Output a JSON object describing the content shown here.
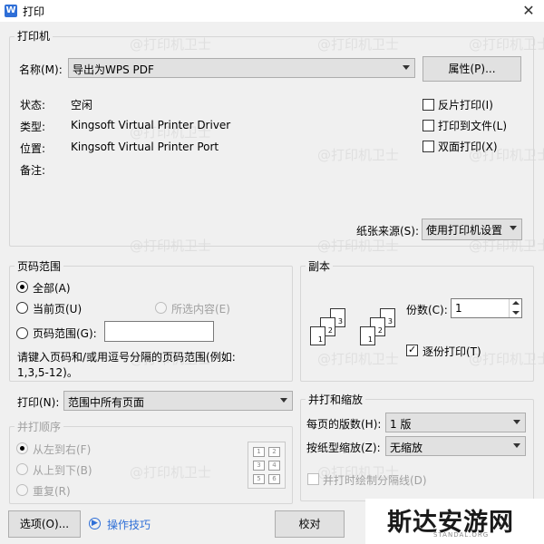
{
  "window": {
    "title": "打印",
    "app_icon": "W"
  },
  "printer": {
    "group_label": "打印机",
    "name_label": "名称(M):",
    "name_value": "导出为WPS PDF",
    "properties_button": "属性(P)...",
    "status_label": "状态:",
    "status_value": "空闲",
    "type_label": "类型:",
    "type_value": "Kingsoft Virtual Printer Driver",
    "location_label": "位置:",
    "location_value": "Kingsoft Virtual Printer Port",
    "comment_label": "备注:",
    "reverse_print": "反片打印(I)",
    "print_to_file": "打印到文件(L)",
    "duplex_print": "双面打印(X)",
    "paper_source_label": "纸张来源(S):",
    "paper_source_value": "使用打印机设置"
  },
  "page_range": {
    "group_label": "页码范围",
    "all": "全部(A)",
    "current_page": "当前页(U)",
    "selection": "所选内容(E)",
    "pages": "页码范围(G):",
    "pages_value": "",
    "hint_line1": "请键入页码和/或用逗号分隔的页码范围(例如:",
    "hint_line2": "1,3,5-12)。"
  },
  "copies": {
    "group_label": "副本",
    "count_label": "份数(C):",
    "count_value": "1",
    "collate": "逐份打印(T)",
    "sheet_numbers": [
      "1",
      "2",
      "3"
    ]
  },
  "print_what": {
    "label": "打印(N):",
    "value": "范围中所有页面"
  },
  "collate_order": {
    "group_label": "并打顺序",
    "left_to_right": "从左到右(F)",
    "top_to_bottom": "从上到下(B)",
    "repeat": "重复(R)",
    "grid_numbers": [
      "1",
      "2",
      "3",
      "4",
      "5",
      "6"
    ]
  },
  "zoom": {
    "group_label": "并打和缩放",
    "pages_per_sheet_label": "每页的版数(H):",
    "pages_per_sheet_value": "1 版",
    "scale_label": "按纸型缩放(Z):",
    "scale_value": "无缩放",
    "draw_separators": "并打时绘制分隔线(D)"
  },
  "footer": {
    "options_button": "选项(O)...",
    "tips_link": "操作技巧",
    "proof_button": "校对"
  },
  "watermark_text": "@打印机卫士",
  "brand": {
    "main": "斯达安游网",
    "sub": "STANDAL.ORG"
  }
}
